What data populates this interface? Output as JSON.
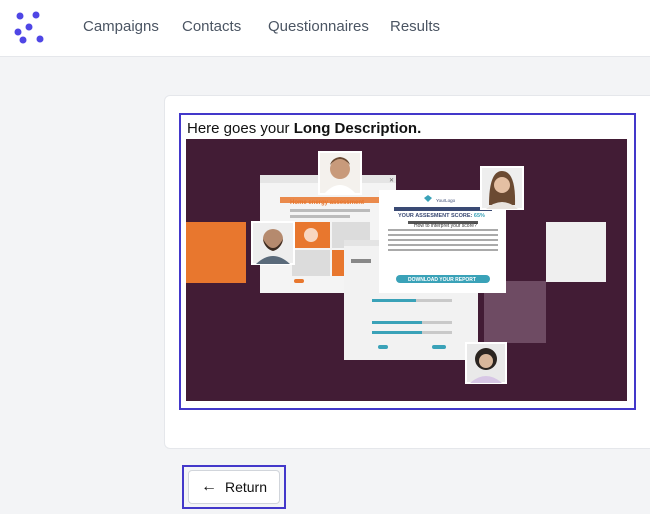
{
  "app": {
    "logo_icon": "dots-logo-icon",
    "brand_color": "#4f46e5"
  },
  "nav": {
    "items": [
      {
        "label": "Campaigns"
      },
      {
        "label": "Contacts"
      },
      {
        "label": "Questionnaires"
      },
      {
        "label": "Results"
      }
    ]
  },
  "content": {
    "description_prefix": "Here goes your ",
    "description_bold": "Long Description.",
    "hero": {
      "logo_text": "YourLogo",
      "score_title": "YOUR ASSESMENT SCORE:",
      "score_value": "65%",
      "interpret_heading": "How to interpret your score?",
      "report_button": "DOWNLOAD YOUR REPORT",
      "questionnaire_title": "Home energy assessment",
      "questionnaire_subtitle": "Which improvements would you like to make? Choose all that apply.",
      "background_color": "#421c35",
      "accent_color": "#e8772e",
      "teal_color": "#3aa2b8"
    }
  },
  "actions": {
    "return_label": "Return",
    "return_icon": "arrow-left-icon"
  }
}
